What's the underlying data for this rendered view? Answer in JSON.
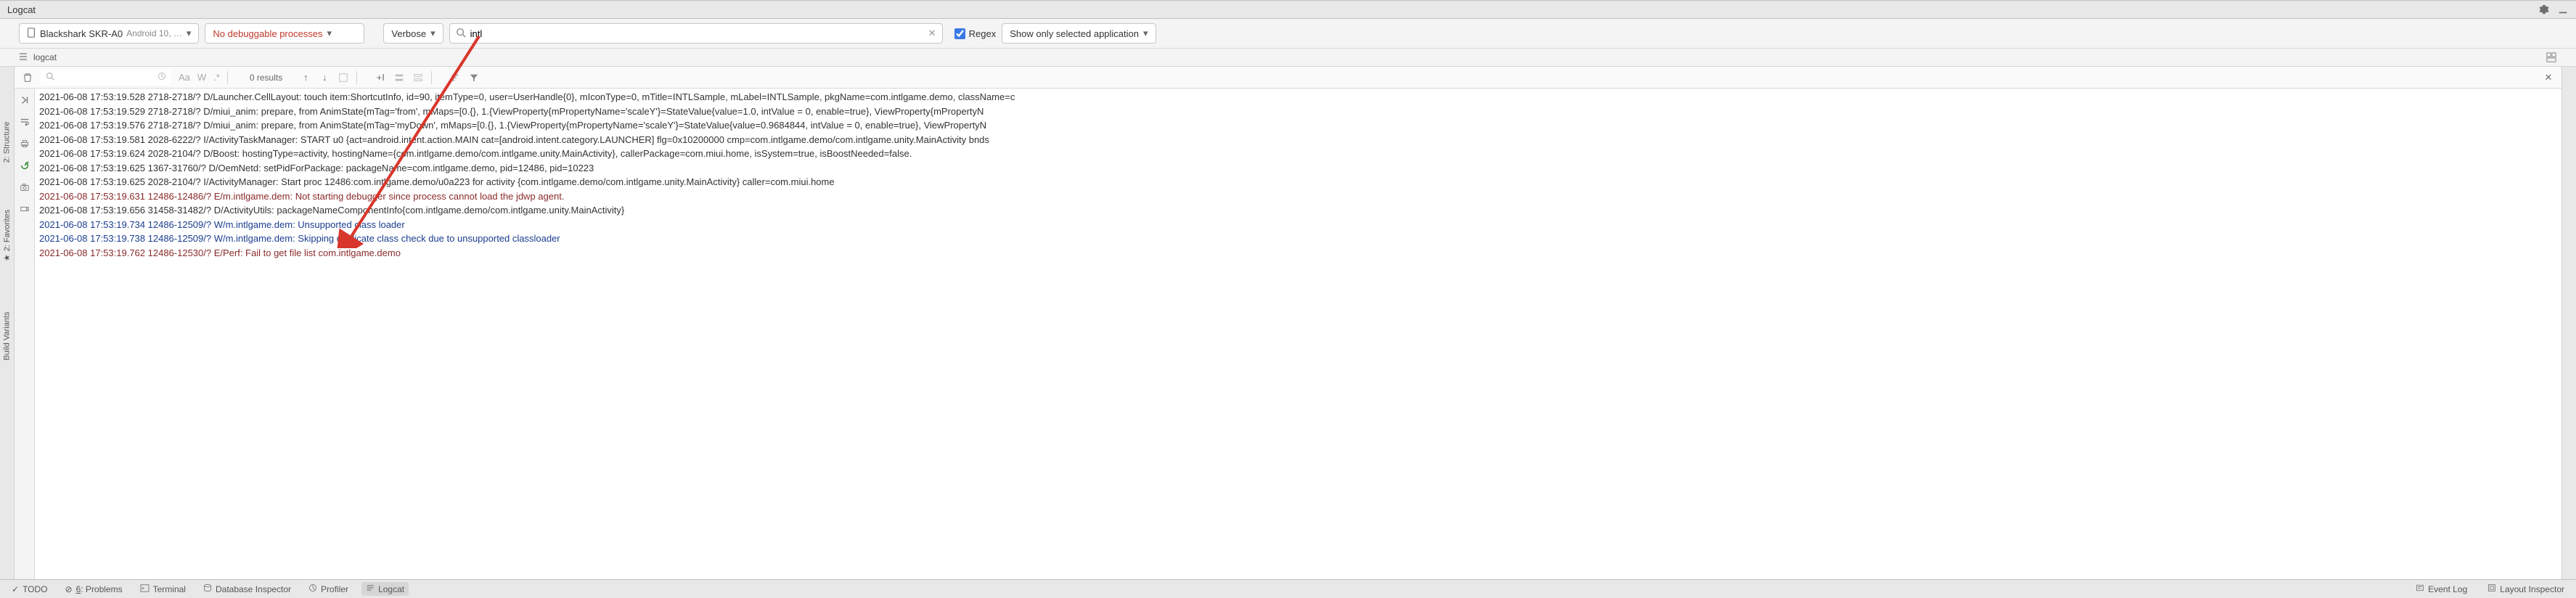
{
  "title": "Logcat",
  "toolbar": {
    "device": "Blackshark SKR-A0",
    "device_sub": "Android 10, …",
    "process": "No debuggable processes",
    "log_level": "Verbose",
    "search_value": "intl",
    "regex_label": "Regex",
    "filter": "Show only selected application"
  },
  "sub_toolbar": {
    "tab_label": "logcat"
  },
  "side_tabs": {
    "structure": "2: Structure",
    "favorites": "2: Favorites",
    "build_variants": "Build Variants"
  },
  "results": {
    "aa_label": "Aa",
    "w_label": "W",
    "results_text": "0 results"
  },
  "log_lines": [
    {
      "level": "info",
      "text": "2021-06-08 17:53:19.528 2718-2718/? D/Launcher.CellLayout: touch item:ShortcutInfo, id=90, itemType=0, user=UserHandle{0}, mIconType=0, mTitle=INTLSample, mLabel=INTLSample, pkgName=com.intlgame.demo, className=c"
    },
    {
      "level": "info",
      "text": "2021-06-08 17:53:19.529 2718-2718/? D/miui_anim: prepare, from AnimState{mTag='from', mMaps=[0.{}, 1.{ViewProperty{mPropertyName='scaleY'}=StateValue{value=1.0, intValue = 0, enable=true}, ViewProperty{mPropertyN"
    },
    {
      "level": "info",
      "text": "2021-06-08 17:53:19.576 2718-2718/? D/miui_anim: prepare, from AnimState{mTag='myDown', mMaps=[0.{}, 1.{ViewProperty{mPropertyName='scaleY'}=StateValue{value=0.9684844, intValue = 0, enable=true}, ViewPropertyN"
    },
    {
      "level": "info",
      "text": "2021-06-08 17:53:19.581 2028-6222/? I/ActivityTaskManager: START u0 {act=android.intent.action.MAIN cat=[android.intent.category.LAUNCHER] flg=0x10200000 cmp=com.intlgame.demo/com.intlgame.unity.MainActivity bnds"
    },
    {
      "level": "info",
      "text": "2021-06-08 17:53:19.624 2028-2104/? D/Boost: hostingType=activity, hostingName={com.intlgame.demo/com.intlgame.unity.MainActivity}, callerPackage=com.miui.home, isSystem=true, isBoostNeeded=false."
    },
    {
      "level": "info",
      "text": "2021-06-08 17:53:19.625 1367-31760/? D/OemNetd: setPidForPackage: packageName=com.intlgame.demo, pid=12486, pid=10223"
    },
    {
      "level": "info",
      "text": "2021-06-08 17:53:19.625 2028-2104/? I/ActivityManager: Start proc 12486:com.intlgame.demo/u0a223 for activity {com.intlgame.demo/com.intlgame.unity.MainActivity} caller=com.miui.home"
    },
    {
      "level": "error",
      "text": "2021-06-08 17:53:19.631 12486-12486/? E/m.intlgame.dem: Not starting debugger since process cannot load the jdwp agent."
    },
    {
      "level": "info",
      "text": "2021-06-08 17:53:19.656 31458-31482/? D/ActivityUtils: packageNameComponentInfo{com.intlgame.demo/com.intlgame.unity.MainActivity}"
    },
    {
      "level": "warn",
      "text": "2021-06-08 17:53:19.734 12486-12509/? W/m.intlgame.dem: Unsupported class loader"
    },
    {
      "level": "warn",
      "text": "2021-06-08 17:53:19.738 12486-12509/? W/m.intlgame.dem: Skipping duplicate class check due to unsupported classloader"
    },
    {
      "level": "error",
      "text": "2021-06-08 17:53:19.762 12486-12530/? E/Perf: Fail to get file list com.intlgame.demo"
    }
  ],
  "bottom_tabs": {
    "todo": "TODO",
    "problems": "6: Problems",
    "terminal": "Terminal",
    "db_inspector": "Database Inspector",
    "profiler": "Profiler",
    "logcat": "Logcat"
  },
  "bottom_right": {
    "event_log": "Event Log",
    "layout_inspector": "Layout Inspector"
  }
}
